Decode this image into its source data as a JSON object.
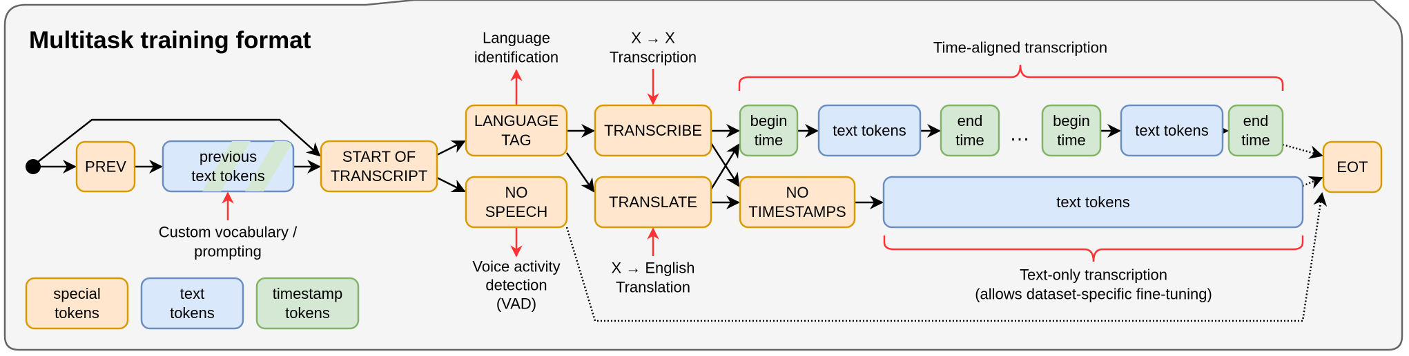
{
  "title": "Multitask training format",
  "colors": {
    "special_fill": "#ffe6cc",
    "special_stroke": "#d79b00",
    "text_fill": "#dae8fc",
    "text_stroke": "#6c8ebf",
    "timestamp_fill": "#d5e8d4",
    "timestamp_stroke": "#82b366",
    "annotation": "#ff3333",
    "panel_fill": "#f5f5f5",
    "panel_stroke": "#666666"
  },
  "nodes": {
    "prev": [
      "PREV"
    ],
    "previous_text_tokens": [
      "previous",
      "text tokens"
    ],
    "start_of_transcript": [
      "START OF",
      "TRANSCRIPT"
    ],
    "language_tag": [
      "LANGUAGE",
      "TAG"
    ],
    "no_speech": [
      "NO",
      "SPEECH"
    ],
    "transcribe": [
      "TRANSCRIBE"
    ],
    "translate": [
      "TRANSLATE"
    ],
    "begin_time_1": [
      "begin",
      "time"
    ],
    "text_tokens_1": [
      "text tokens"
    ],
    "end_time_1": [
      "end",
      "time"
    ],
    "ellipsis": "…",
    "begin_time_2": [
      "begin",
      "time"
    ],
    "text_tokens_2": [
      "text tokens"
    ],
    "end_time_2": [
      "end",
      "time"
    ],
    "no_timestamps": [
      "NO",
      "TIMESTAMPS"
    ],
    "text_tokens_long": [
      "text tokens"
    ],
    "eot": [
      "EOT"
    ]
  },
  "annotations": {
    "language_identification": [
      "Language",
      "identification"
    ],
    "x_to_x_transcription": [
      "X → X",
      "Transcription"
    ],
    "custom_vocabulary": [
      "Custom vocabulary /",
      "prompting"
    ],
    "vad": [
      "Voice activity",
      "detection",
      "(VAD)"
    ],
    "x_to_english": [
      "X → English",
      "Translation"
    ],
    "time_aligned": [
      "Time-aligned transcription"
    ],
    "text_only": [
      "Text-only transcription",
      "(allows dataset-specific fine-tuning)"
    ]
  },
  "legend": [
    {
      "kind": "special",
      "lines": [
        "special",
        "tokens"
      ]
    },
    {
      "kind": "text",
      "lines": [
        "text",
        "tokens"
      ]
    },
    {
      "kind": "timestamp",
      "lines": [
        "timestamp",
        "tokens"
      ]
    }
  ]
}
